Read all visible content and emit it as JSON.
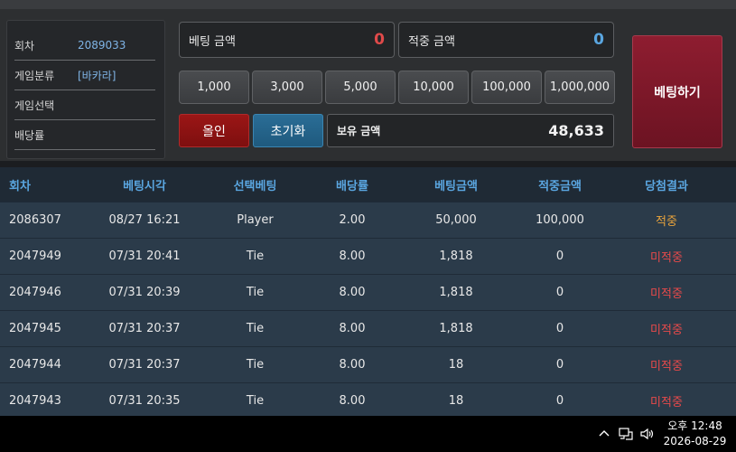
{
  "info": {
    "rows": [
      {
        "label": "회차",
        "value": "2089033"
      },
      {
        "label": "게임분류",
        "value": "[바카라]"
      },
      {
        "label": "게임선택",
        "value": ""
      },
      {
        "label": "배당률",
        "value": ""
      }
    ]
  },
  "bet": {
    "bet_amount_label": "베팅 금액",
    "bet_amount_value": "0",
    "win_amount_label": "적중 금액",
    "win_amount_value": "0",
    "chips": [
      "1,000",
      "3,000",
      "5,000",
      "10,000",
      "100,000",
      "1,000,000"
    ],
    "all_in_label": "올인",
    "reset_label": "초기화",
    "balance_label": "보유 금액",
    "balance_value": "48,633",
    "place_bet_label": "베팅하기"
  },
  "history": {
    "headers": [
      "회차",
      "베팅시각",
      "선택베팅",
      "배당률",
      "베팅금액",
      "적중금액",
      "당첨결과"
    ],
    "rows": [
      [
        "2086307",
        "08/27 16:21",
        "Player",
        "2.00",
        "50,000",
        "100,000",
        "적중"
      ],
      [
        "2047949",
        "07/31 20:41",
        "Tie",
        "8.00",
        "1,818",
        "0",
        "미적중"
      ],
      [
        "2047946",
        "07/31 20:39",
        "Tie",
        "8.00",
        "1,818",
        "0",
        "미적중"
      ],
      [
        "2047945",
        "07/31 20:37",
        "Tie",
        "8.00",
        "1,818",
        "0",
        "미적중"
      ],
      [
        "2047944",
        "07/31 20:37",
        "Tie",
        "8.00",
        "18",
        "0",
        "미적중"
      ],
      [
        "2047943",
        "07/31 20:35",
        "Tie",
        "8.00",
        "18",
        "0",
        "미적중"
      ]
    ]
  },
  "taskbar": {
    "time": "오후 12:48",
    "date": "2026-08-29",
    "icons": [
      "chevron-up-icon",
      "network-icon",
      "volume-icon"
    ]
  },
  "colors": {
    "bet_amount": "#e04a4a",
    "win_amount": "#5aa6e0",
    "hit": "#e8a33c",
    "miss": "#e84a4a",
    "header_text": "#5aa6e0",
    "place_bet_bg": "#7c1828"
  }
}
